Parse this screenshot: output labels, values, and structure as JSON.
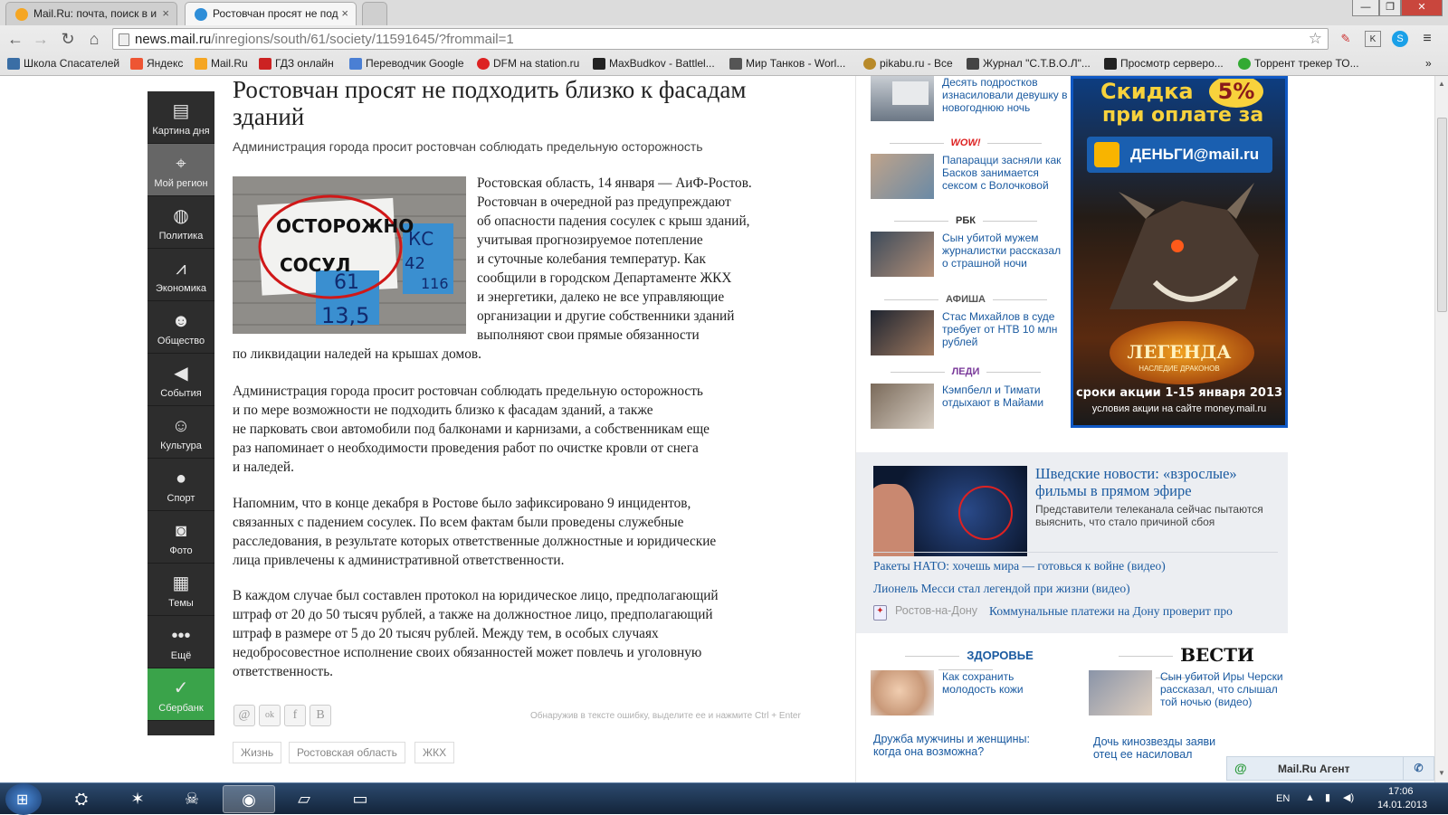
{
  "browser": {
    "tabs": [
      {
        "title": "Mail.Ru: почта, поиск в и"
      },
      {
        "title": "Ростовчан просят не под"
      }
    ],
    "url_host": "news.mail.ru",
    "url_path": "/inregions/south/61/society/11591645/?frommail=1",
    "window_buttons": [
      "—",
      "❐",
      "✕"
    ],
    "bookmarks": [
      "Школа Спасателей",
      "Яндекс",
      "Mail.Ru",
      "ГДЗ онлайн",
      "Переводчик Google",
      "DFM на station.ru",
      "MaxBudkov - Battlel...",
      "Мир Танков - Worl...",
      "pikabu.ru - Все",
      "Журнал \"С.Т.В.О.Л\"...",
      "Просмотр серверо...",
      "Торрент трекер ТО..."
    ]
  },
  "leftnav": {
    "items": [
      {
        "label": "Картина дня",
        "icon": "newspaper-icon",
        "glyph": "▤"
      },
      {
        "label": "Мой регион",
        "icon": "map-pin-icon",
        "glyph": "⌖"
      },
      {
        "label": "Политика",
        "icon": "globe-icon",
        "glyph": "◍"
      },
      {
        "label": "Экономика",
        "icon": "chart-icon",
        "glyph": "⩘"
      },
      {
        "label": "Общество",
        "icon": "people-icon",
        "glyph": "☻"
      },
      {
        "label": "События",
        "icon": "megaphone-icon",
        "glyph": "◀"
      },
      {
        "label": "Культура",
        "icon": "masks-icon",
        "glyph": "☺"
      },
      {
        "label": "Спорт",
        "icon": "ball-icon",
        "glyph": "●"
      },
      {
        "label": "Фото",
        "icon": "camera-icon",
        "glyph": "◙"
      },
      {
        "label": "Темы",
        "icon": "stack-icon",
        "glyph": "▦"
      },
      {
        "label": "Ещё",
        "icon": "more-icon",
        "glyph": "•••"
      },
      {
        "label": "Сбербанк",
        "icon": "sberbank-icon",
        "glyph": "✓"
      }
    ]
  },
  "article": {
    "title": "Ростовчан просят не подходить близко к фасадам зданий",
    "lead": "Администрация города просит ростовчан соблюдать предельную осторожность",
    "photo_sign_line1": "ОСТОРОЖНО",
    "photo_sign_line2": "СОСУЛ",
    "photo_plate1": "КС",
    "photo_plate2": "42",
    "photo_plate3": "116",
    "photo_plate4": "13,5",
    "photo_plate5": "61",
    "p1": [
      "Ростовская область, 14 января — АиФ-Ростов.",
      "Ростовчан в очередной раз предупреждают",
      "об опасности падения сосулек с крыш зданий,",
      "учитывая прогнозируемое потепление",
      "и суточные колебания температур. Как",
      "сообщили в городском Департаменте ЖКХ",
      "и энергетики, далеко не все управляющие",
      "организации и другие собственники зданий",
      "выполняют свои прямые обязанности",
      "по ликвидации наледей на крышах домов."
    ],
    "p2": [
      "Администрация города просит ростовчан соблюдать предельную осторожность",
      "и по мере возможности не подходить близко к фасадам зданий, а также",
      "не парковать свои автомобили под балконами и карнизами, а собственникам еще",
      "раз напоминает о необходимости проведения работ по очистке кровли от снега",
      "и наледей."
    ],
    "p3": [
      "Напомним, что в конце декабря в Ростове было зафиксировано 9 инцидентов,",
      "связанных с падением сосулек. По всем фактам были проведены служебные",
      "расследования, в результате которых ответственные должностные и юридические",
      "лица привлечены к административной ответственности."
    ],
    "p4": [
      "В каждом случае был составлен протокол на юридическое лицо, предполагающий",
      "штраф от 20 до 50 тысяч рублей, а также на должностное лицо, предполагающий",
      "штраф в размере от 5 до 20 тысяч рублей. Между тем, в особых случаях",
      "недобросовестное исполнение своих обязанностей может повлечь и уголовную",
      "ответственность."
    ],
    "share": [
      "@",
      "ok",
      "f",
      "B"
    ],
    "error_hint": "Обнаружив в тексте ошибку, выделите ее и нажмите Ctrl + Enter",
    "tags": [
      "Жизнь",
      "Ростовская область",
      "ЖКХ"
    ]
  },
  "sidebar": {
    "news": [
      {
        "text": "Десять подростков изнасиловали девушку в новогоднюю ночь"
      },
      {
        "brand": "WOW!",
        "text": "Папарацци засняли как Басков занимается сексом с Волочковой"
      },
      {
        "brand": "РБК",
        "text": "Сын убитой мужем журналистки рассказал о страшной ночи"
      },
      {
        "brand": "АФИША",
        "text": "Стас Михайлов в суде требует от НТВ 10 млн рублей"
      },
      {
        "brand": "ЛЕДИ",
        "text": "Кэмпбелл и Тимати отдыхают в Майами"
      }
    ],
    "ad": {
      "line1": "Скидка",
      "pct": "5%",
      "line2": "при оплате за",
      "brand": "ДЕНЬГИ@mail.ru",
      "game": "ЛЕГЕНДА",
      "game_sub": "НАСЛЕДИЕ ДРАКОНОВ",
      "promo": "сроки акции 1-15 января 2013",
      "promo_sub": "условия акции на сайте money.mail.ru"
    },
    "feature": {
      "headline": "Шведские новости: «взрослые» фильмы в прямом эфире",
      "sub": "Представители телеканала сейчас пытаются выяснить, что стало причиной сбоя"
    },
    "links": [
      "Ракеты НАТО: хочешь мира — готовься к войне (видео)",
      "Лионель Месси стал легендой при жизни (видео)"
    ],
    "region_label": "Ростов-на-Дону",
    "region_link": "Коммунальные платежи на Дону проверит про",
    "zdorovie_brand": "ЗДОРОВЬЕ",
    "zdorovie_text": "Как сохранить молодость кожи",
    "zdorovie_link": "Дружба мужчины и женщины: когда она возможна?",
    "vesti_brand": "ВЕСТИ",
    "vesti_text": "Сын убитой Иры Черски рассказал, что слышал той ночью (видео)",
    "vesti_link": "Дочь кинозвезды заяви отец ее насиловал"
  },
  "agent": {
    "label": "Mail.Ru Агент"
  },
  "taskbar": {
    "lang": "EN",
    "time": "17:06",
    "date": "14.01.2013"
  }
}
